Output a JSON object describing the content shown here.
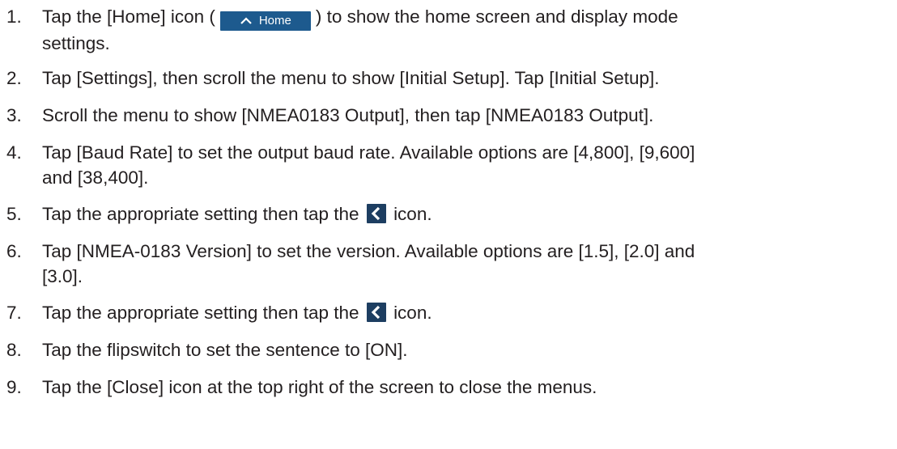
{
  "steps": [
    {
      "num": "1.",
      "pre": "Tap the [Home] icon (",
      "button_label": "Home",
      "post": ") to show the home screen and display mode",
      "cont": "settings."
    },
    {
      "num": "2.",
      "text": "Tap [Settings], then scroll the menu to show [Initial Setup]. Tap [Initial Setup]."
    },
    {
      "num": "3.",
      "text": "Scroll the menu to show [NMEA0183 Output], then tap [NMEA0183 Output]."
    },
    {
      "num": "4.",
      "line1": "Tap [Baud Rate] to set the output baud rate. Available options are [4,800], [9,600]",
      "line2": "and [38,400]."
    },
    {
      "num": "5.",
      "pre": "Tap the appropriate setting then tap the",
      "post": "icon."
    },
    {
      "num": "6.",
      "line1": "Tap [NMEA-0183 Version] to set the version. Available options are [1.5], [2.0] and",
      "line2": "[3.0]."
    },
    {
      "num": "7.",
      "pre": "Tap the appropriate setting then tap the",
      "post": "icon."
    },
    {
      "num": "8.",
      "text": "Tap the flipswitch to set the sentence to [ON]."
    },
    {
      "num": "9.",
      "text": "Tap the [Close] icon at the top right of the screen to close the menus."
    }
  ],
  "icons": {
    "home": "home-icon",
    "back": "chevron-left-icon"
  },
  "colors": {
    "home_button_bg": "#1d5a8e",
    "back_icon_bg": "#1d3e61",
    "text": "#231f20"
  }
}
